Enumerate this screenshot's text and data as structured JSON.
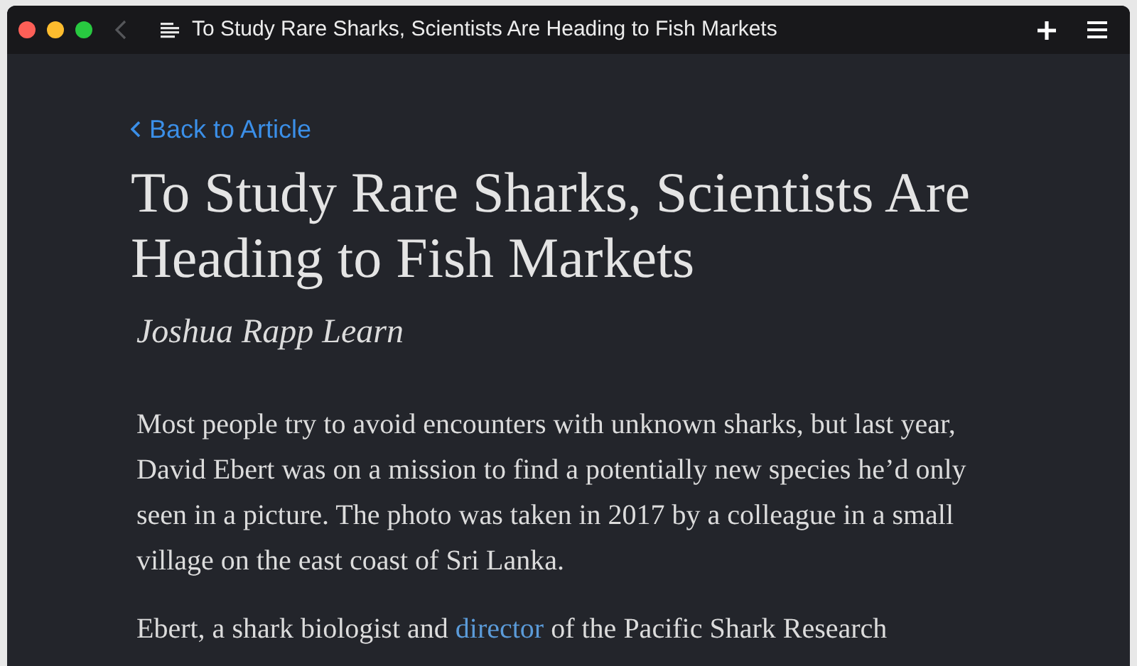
{
  "window": {
    "title": "To Study Rare Sharks, Scientists Are Heading to Fish Markets"
  },
  "back_link": "Back to Article",
  "article": {
    "title": "To Study Rare Sharks, Scientists Are Heading to Fish Markets",
    "author": "Joshua Rapp Learn",
    "paragraphs": [
      {
        "text": "Most people try to avoid encounters with unknown sharks, but last year, David Ebert was on a mission to find a potentially new species he’d only seen in a picture. The photo was taken in 2017 by a colleague in a small village on the east coast of Sri Lanka."
      },
      {
        "before": "Ebert, a shark biologist and ",
        "link": "director",
        "after": " of the Pacific Shark Research"
      }
    ]
  }
}
